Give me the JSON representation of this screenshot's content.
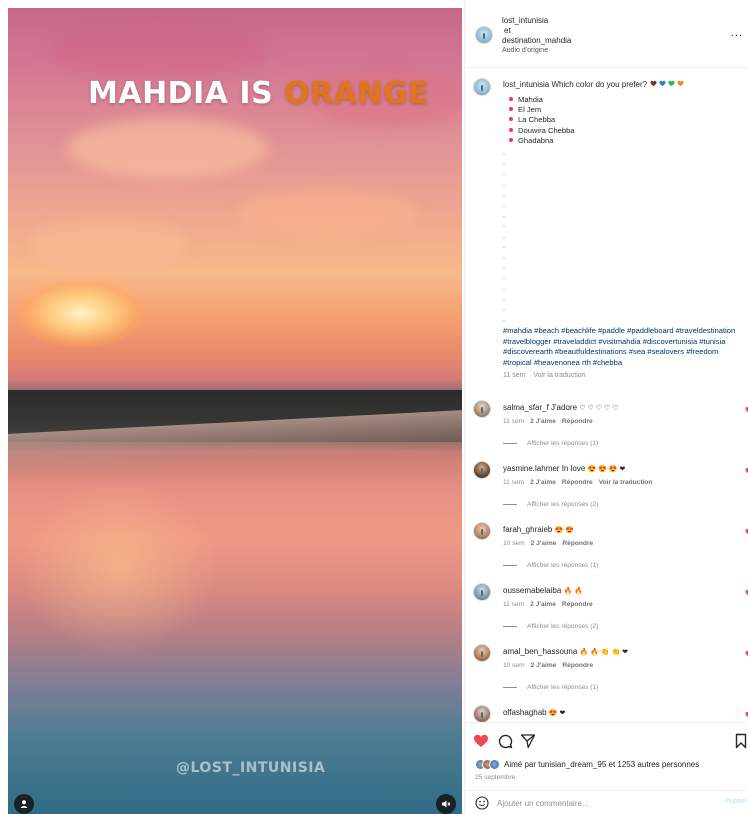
{
  "media": {
    "title_part1": "MAHDIA IS ",
    "title_part2": "ORANGE",
    "watermark": "@LOST_INTUNISIA"
  },
  "header": {
    "user1": "lost_intunisia",
    "conj": "et",
    "user2": "destination_mahdia",
    "audio": "Audio d'origine",
    "more": "..."
  },
  "caption": {
    "username": "lost_intunisia",
    "text": "Which color do you prefer?",
    "emoji_hearts": [
      "#6b3f2a",
      "#2f7bd8",
      "#33b54a",
      "#f08a24"
    ],
    "options": [
      "Mahdia",
      "El Jem",
      "La Chebba",
      "Douwira Chebba",
      "Ghadabna"
    ],
    "dot_count": 17,
    "dot": ".",
    "hashtags": "#mahdia #beach #beachlife #paddle #paddleboard #traveldestination #travelblogger #traveladdict #visitmahdia #discovertunisia #tunisia #discoverearth #beautfuldestinations #sea #sealovers #freedom #tropical #heavenonea rth #chebba",
    "time": "11 sem",
    "translate": "Voir la traduction"
  },
  "comments": [
    {
      "username": "salma_sfar_f",
      "text": "J'adore",
      "emoji": "♡ ♡ ♡ ♡ ♡",
      "time": "11 sem",
      "likes": "2 J'aime",
      "reply": "Répondre",
      "translate": "",
      "replies": "Afficher les réponses (1)"
    },
    {
      "username": "yasmine.lahmer",
      "text": "In love",
      "emoji": "😍 😍 😍 ❤",
      "time": "11 sem",
      "likes": "2 J'aime",
      "reply": "Répondre",
      "translate": "Voir la traduction",
      "replies": "Afficher les réponses (2)"
    },
    {
      "username": "farah_ghraieb",
      "text": "",
      "emoji": "😍 😍",
      "time": "10 sem",
      "likes": "2 J'aime",
      "reply": "Répondre",
      "translate": "",
      "replies": "Afficher les réponses (1)"
    },
    {
      "username": "oussemabelaiba",
      "text": "",
      "emoji": "🔥 🔥",
      "time": "11 sem",
      "likes": "2 J'aime",
      "reply": "Répondre",
      "translate": "",
      "replies": "Afficher les réponses (2)"
    },
    {
      "username": "amal_ben_hassouna",
      "text": "",
      "emoji": "🔥 🔥 👏 👏 ❤",
      "time": "10 sem",
      "likes": "2 J'aime",
      "reply": "Répondre",
      "translate": "",
      "replies": "Afficher les réponses (1)"
    },
    {
      "username": "olfashaghab",
      "text": "",
      "emoji": "😍 ❤",
      "time": "",
      "likes": "",
      "reply": "",
      "translate": "",
      "replies": ""
    }
  ],
  "actions": {
    "liked_prefix": "Aimé par ",
    "liked_user": "tunisian_dream_95",
    "liked_rest": " et 1253 autres personnes",
    "date": "25 septembre"
  },
  "add_comment": {
    "placeholder": "Ajouter un commentaire...",
    "publish": "Publier"
  },
  "colors": {
    "like_red": "#ed4956",
    "title_accent": "#e0761b",
    "hashtag_blue": "#00376b"
  }
}
